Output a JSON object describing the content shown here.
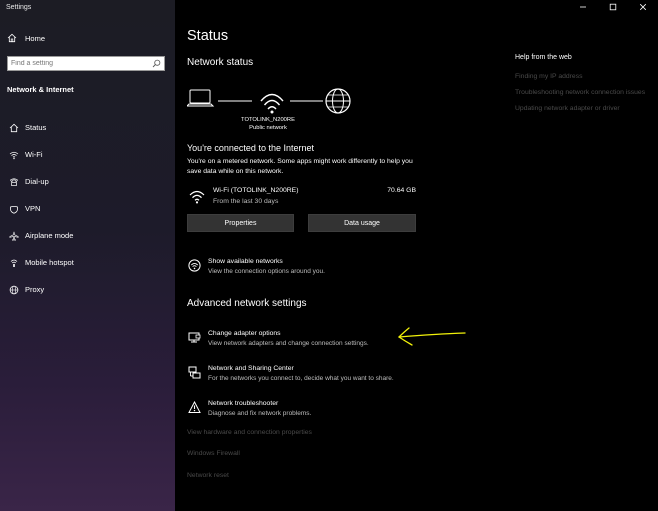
{
  "window": {
    "title": "Settings"
  },
  "sidebar": {
    "home_label": "Home",
    "search_placeholder": "Find a setting",
    "section_title": "Network & Internet",
    "items": [
      {
        "label": "Status",
        "icon": "home-icon"
      },
      {
        "label": "Wi-Fi",
        "icon": "wifi-icon"
      },
      {
        "label": "Dial-up",
        "icon": "phone-icon"
      },
      {
        "label": "VPN",
        "icon": "vpn-icon"
      },
      {
        "label": "Airplane mode",
        "icon": "airplane-icon"
      },
      {
        "label": "Mobile hotspot",
        "icon": "hotspot-icon"
      },
      {
        "label": "Proxy",
        "icon": "globe-icon"
      }
    ]
  },
  "main": {
    "page_title": "Status",
    "network_status_heading": "Network status",
    "network_name": "TOTOLINK_N200RE",
    "network_type": "Public network",
    "connected_heading": "You're connected to the Internet",
    "connected_desc": "You're on a metered network. Some apps might work differently to help you save data while on this network.",
    "connection": {
      "name": "Wi-Fi (TOTOLINK_N200RE)",
      "period": "From the last 30 days",
      "usage": "70.64 GB"
    },
    "buttons": {
      "properties": "Properties",
      "data_usage": "Data usage"
    },
    "show_networks": {
      "title": "Show available networks",
      "desc": "View the connection options around you."
    },
    "advanced_heading": "Advanced network settings",
    "advanced_items": [
      {
        "title": "Change adapter options",
        "desc": "View network adapters and change connection settings.",
        "icon": "adapter-icon"
      },
      {
        "title": "Network and Sharing Center",
        "desc": "For the networks you connect to, decide what you want to share.",
        "icon": "sharing-icon"
      },
      {
        "title": "Network troubleshooter",
        "desc": "Diagnose and fix network problems.",
        "icon": "warning-icon"
      }
    ],
    "links": [
      "View hardware and connection properties",
      "Windows Firewall",
      "Network reset"
    ]
  },
  "help": {
    "heading": "Help from the web",
    "links": [
      "Finding my IP address",
      "Troubleshooting network connection issues",
      "Updating network adapter or driver"
    ]
  },
  "colors": {
    "background": "#000000",
    "accent_arrow": "#f2f20a",
    "link_disabled": "#4a4a4a"
  }
}
